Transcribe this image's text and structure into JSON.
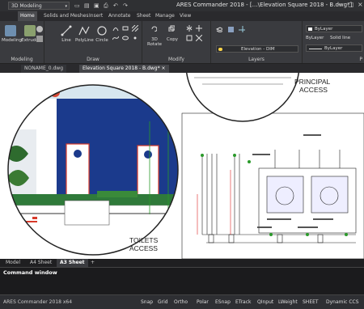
{
  "titlebar": {
    "workspace": "3D Modeling",
    "title": "ARES Commander 2018 - […\\Elevation Square 2018 - B.dwg*]"
  },
  "ribbon_tabs": [
    "Home",
    "Solids and Meshes",
    "Insert",
    "Annotate",
    "Sheet",
    "Manage",
    "View"
  ],
  "ribbon": {
    "modeling": {
      "label": "Modeling",
      "buttons": [
        "Modeling",
        "Extrude"
      ]
    },
    "draw": {
      "label": "Draw",
      "buttons": [
        "Line",
        "PolyLine",
        "Circle"
      ]
    },
    "modify": {
      "label": "Modify",
      "buttons": [
        "3D Rotate",
        "Copy"
      ]
    },
    "layers": {
      "label": "Layers",
      "current_layer": "Elevation - DIM"
    },
    "properties": {
      "label": "P",
      "color": "ByLayer",
      "linetype_label": "ByLayer",
      "linetype": "Solid line",
      "lineweight": "ByLayer"
    }
  },
  "doc_tabs": [
    "NONAME_0.dwg",
    "Elevation Square 2018 - B.dwg*"
  ],
  "drawing": {
    "principal_access": [
      "PRINCIPAL",
      "ACCESS"
    ],
    "toilets_access": [
      "TOILETS",
      "ACCESS"
    ]
  },
  "layout_tabs": [
    "Model",
    "A4 Sheet",
    "A3 Sheet",
    "+"
  ],
  "command": {
    "label": "Command window"
  },
  "status": {
    "app": "ARES Commander 2018 x64",
    "toggles": [
      "Snap",
      "Grid",
      "Ortho",
      "Polar",
      "ESnap",
      "ETrack",
      "QInput",
      "LWeight",
      "SHEET",
      "Dynamic CCS"
    ]
  },
  "colors": {
    "ribbon_bg": "#3a3b3f",
    "canvas_bg": "#ffffff",
    "wall_blue": "#1b3a8c",
    "door_red": "#d83a2a"
  }
}
